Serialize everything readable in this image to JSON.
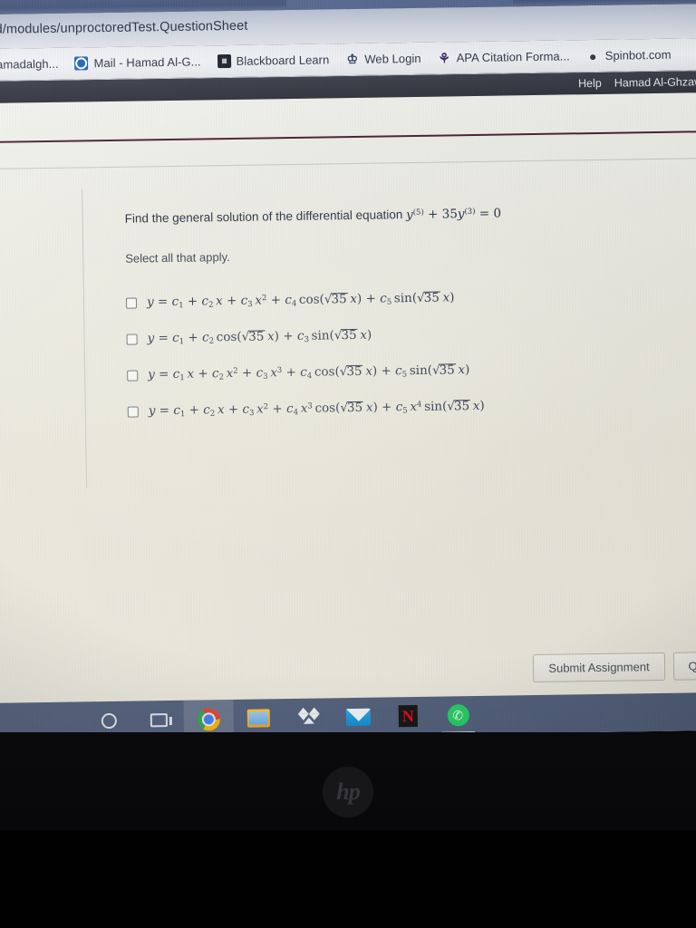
{
  "browser": {
    "url": "ud/modules/unproctoredTest.QuestionSheet",
    "bookmarks": [
      {
        "label": "amadalgh...",
        "icon": "generic-bookmark-icon"
      },
      {
        "label": "Mail - Hamad Al-G...",
        "icon": "mail-icon"
      },
      {
        "label": "Blackboard Learn",
        "icon": "blackboard-icon"
      },
      {
        "label": "Web Login",
        "icon": "shield-icon"
      },
      {
        "label": "APA Citation Forma...",
        "icon": "apa-icon"
      },
      {
        "label": "Spinbot.com",
        "icon": "spinbot-icon"
      }
    ]
  },
  "page_header": {
    "help_label": "Help",
    "user_label": "Hamad Al-Ghzawi ("
  },
  "question": {
    "stem_prefix": "Find the general solution of the differential equation",
    "equation": "y(5) + 35y(3) = 0",
    "equation_parts": {
      "y1": "y",
      "sup1": "(5)",
      "plus": "+ 35",
      "y2": "y",
      "sup2": "(3)",
      "equals": "= 0"
    },
    "instruction": "Select all that apply.",
    "choices": [
      {
        "id": "choice-1",
        "checked": false,
        "text": "y = c1 + c2 x + c3 x^2 + c4 cos(sqrt(35) x) + c5 sin(sqrt(35) x)"
      },
      {
        "id": "choice-2",
        "checked": false,
        "text": "y = c1 + c2 cos(sqrt(35) x) + c3 sin(sqrt(35) x)"
      },
      {
        "id": "choice-3",
        "checked": false,
        "text": "y = c1 x + c2 x^2 + c3 x^3 + c4 cos(sqrt(35) x) + c5 sin(sqrt(35) x)"
      },
      {
        "id": "choice-4",
        "checked": false,
        "text": "y = c1 + c2 x + c3 x^2 + c4 x^3 cos(sqrt(35) x) + c5 x^4 sin(sqrt(35) x)"
      }
    ]
  },
  "actions": {
    "submit_label": "Submit Assignment",
    "quit_label": "Quit & S"
  },
  "taskbar": {
    "items": [
      {
        "name": "cortana-icon",
        "label": "Cortana"
      },
      {
        "name": "task-view-icon",
        "label": "Task View"
      },
      {
        "name": "chrome-icon",
        "label": "Google Chrome"
      },
      {
        "name": "file-explorer-icon",
        "label": "File Explorer"
      },
      {
        "name": "dropbox-icon",
        "label": "Dropbox"
      },
      {
        "name": "mail-app-icon",
        "label": "Mail"
      },
      {
        "name": "netflix-icon",
        "label": "Netflix",
        "glyph": "N"
      },
      {
        "name": "whatsapp-icon",
        "label": "WhatsApp",
        "glyph": "✆"
      }
    ]
  },
  "hardware": {
    "brand_logo": "hp"
  },
  "colors": {
    "maroon_rule": "#4a1f33",
    "taskbar": "#53617d",
    "page_bg": "#eceade",
    "formula_text": "#26304a",
    "chrome_omnibox": "#cdd3e0"
  }
}
